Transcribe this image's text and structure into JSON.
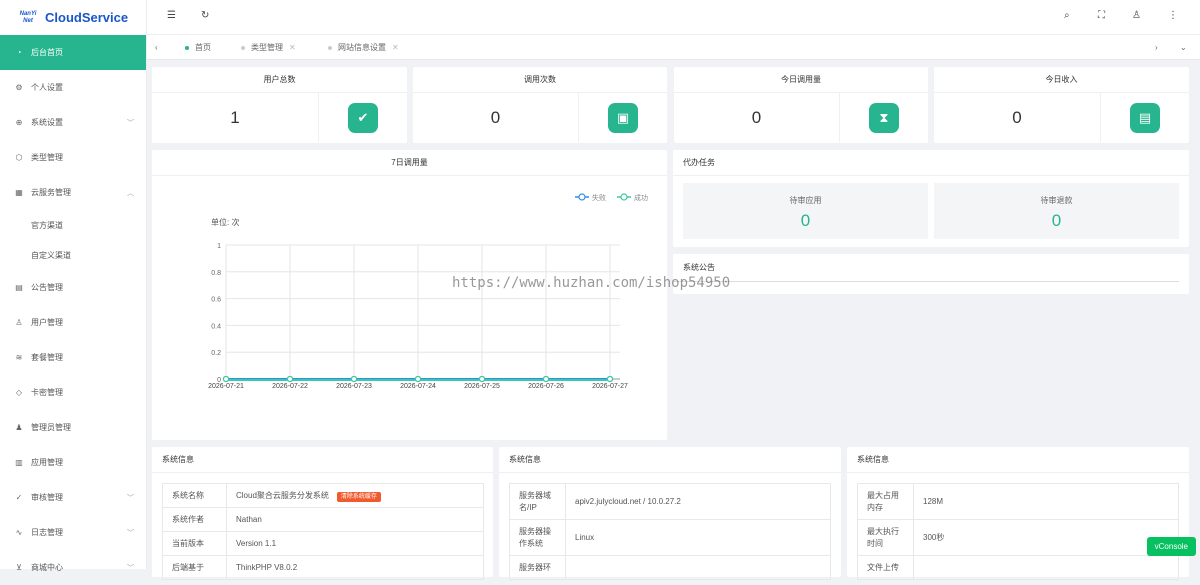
{
  "app": {
    "title": "CloudService",
    "logo_line1": "NanYi",
    "logo_line2": "Net"
  },
  "sidebar": {
    "items": [
      {
        "label": "后台首页",
        "icon": "dashboard-icon"
      },
      {
        "label": "个人设置",
        "icon": "gear-icon"
      },
      {
        "label": "系统设置",
        "icon": "globe-icon"
      },
      {
        "label": "类型管理",
        "icon": "cube-icon"
      },
      {
        "label": "云服务管理",
        "icon": "apps-icon"
      },
      {
        "label": "官方渠道"
      },
      {
        "label": "自定义渠道"
      },
      {
        "label": "公告管理",
        "icon": "calendar-icon"
      },
      {
        "label": "用户管理",
        "icon": "user-icon"
      },
      {
        "label": "套餐管理",
        "icon": "layers-icon"
      },
      {
        "label": "卡密管理",
        "icon": "diamond-icon"
      },
      {
        "label": "管理员管理",
        "icon": "group-icon"
      },
      {
        "label": "应用管理",
        "icon": "app-icon"
      },
      {
        "label": "审核管理",
        "icon": "check-circle-icon"
      },
      {
        "label": "日志管理",
        "icon": "pulse-icon"
      },
      {
        "label": "商城中心",
        "icon": "cart-icon"
      }
    ]
  },
  "tabs": [
    {
      "label": "首页"
    },
    {
      "label": "类型管理"
    },
    {
      "label": "网站信息设置"
    }
  ],
  "stats": [
    {
      "title": "用户总数",
      "value": "1",
      "icon": "check-badge-icon"
    },
    {
      "title": "调用次数",
      "value": "0",
      "icon": "book-icon"
    },
    {
      "title": "今日调用量",
      "value": "0",
      "icon": "hourglass-icon"
    },
    {
      "title": "今日收入",
      "value": "0",
      "icon": "notebook-icon"
    }
  ],
  "chart_panel": {
    "title": "7日调用量",
    "unit": "单位: 次"
  },
  "chart_data": {
    "type": "line",
    "title": "7日调用量",
    "x": [
      "2026-07-21",
      "2026-07-22",
      "2026-07-23",
      "2026-07-24",
      "2026-07-25",
      "2026-07-26",
      "2026-07-27"
    ],
    "series": [
      {
        "name": "失败",
        "values": [
          0,
          0,
          0,
          0,
          0,
          0,
          0
        ],
        "color": "#2f8fe8"
      },
      {
        "name": "成功",
        "values": [
          0,
          0,
          0,
          0,
          0,
          0,
          0
        ],
        "color": "#3cc9a5"
      }
    ],
    "ylim": [
      0,
      1
    ],
    "yticks": [
      "0",
      "0.2",
      "0.4",
      "0.6",
      "0.8",
      "1"
    ],
    "legend": "top-right",
    "grid": true
  },
  "todo": {
    "title": "代办任务",
    "items": [
      {
        "label": "待审应用",
        "value": "0"
      },
      {
        "label": "待审退款",
        "value": "0"
      }
    ]
  },
  "notice": {
    "title": "系统公告"
  },
  "watermark": "https://www.huzhan.com/ishop54950",
  "sysinfo": [
    {
      "title": "系统信息",
      "rows": [
        [
          "系统名称",
          "Cloud聚合云服务分发系统"
        ],
        [
          "系统作者",
          "Nathan"
        ],
        [
          "当前版本",
          "Version 1.1"
        ],
        [
          "后端基于",
          "ThinkPHP V8.0.2"
        ]
      ],
      "badge": "清除系统缓存"
    },
    {
      "title": "系统信息",
      "rows": [
        [
          "服务器域名/IP",
          "apiv2.julycloud.net / 10.0.27.2"
        ],
        [
          "服务器操作系统",
          "Linux"
        ],
        [
          "服务器环",
          ""
        ]
      ]
    },
    {
      "title": "系统信息",
      "rows": [
        [
          "最大占用内存",
          "128M"
        ],
        [
          "最大执行时间",
          "300秒"
        ],
        [
          "文件上传",
          ""
        ]
      ]
    }
  ],
  "vconsole": "vConsole"
}
